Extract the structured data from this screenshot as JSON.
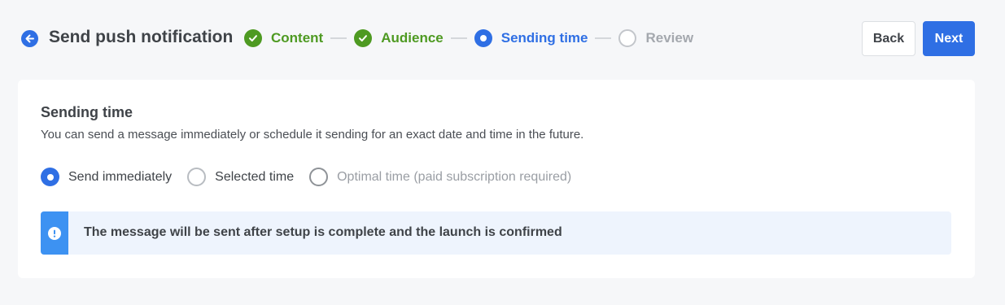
{
  "header": {
    "title": "Send push notification",
    "back_icon": "arrow-left-icon"
  },
  "stepper": {
    "steps": [
      {
        "label": "Content",
        "state": "done"
      },
      {
        "label": "Audience",
        "state": "done"
      },
      {
        "label": "Sending time",
        "state": "current"
      },
      {
        "label": "Review",
        "state": "pending"
      }
    ]
  },
  "actions": {
    "back_label": "Back",
    "next_label": "Next"
  },
  "sending_time": {
    "title": "Sending time",
    "description": "You can send a message immediately or schedule it sending for an exact date and time in the future.",
    "options": [
      {
        "label": "Send immediately",
        "selected": true,
        "disabled": false
      },
      {
        "label": "Selected time",
        "selected": false,
        "disabled": false
      },
      {
        "label": "Optimal time (paid subscription required)",
        "selected": false,
        "disabled": true
      }
    ],
    "notice": "The message will be sent after setup is complete and the launch is confirmed"
  },
  "colors": {
    "accent": "#2f6fe4",
    "done": "#4e9a22",
    "pending": "#a4a8ae",
    "info": "#3d92f2",
    "info_bg": "#eef4fd"
  }
}
